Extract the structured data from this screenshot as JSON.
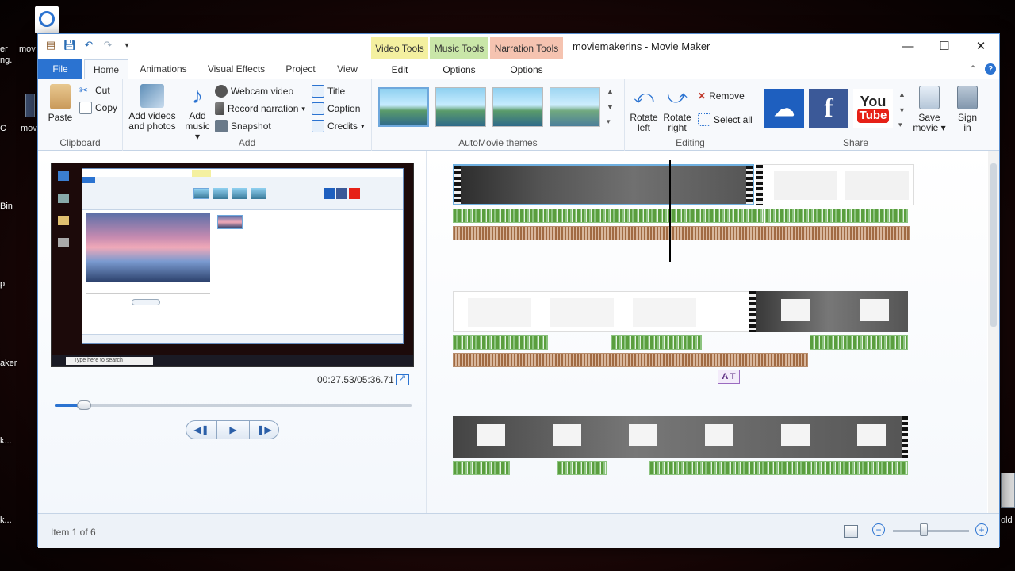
{
  "desktop": {
    "icons": [
      "er",
      "mov",
      "ng.",
      "C",
      "mov",
      "Bin",
      "p",
      "aker",
      "k...",
      "k...",
      "old"
    ]
  },
  "window": {
    "title": "moviemakerins - Movie Maker",
    "contextual_tabs": [
      {
        "group": "Video Tools",
        "tab": "Edit",
        "color": "#f4f0a0"
      },
      {
        "group": "Music Tools",
        "tab": "Options",
        "color": "#c9e6a8"
      },
      {
        "group": "Narration Tools",
        "tab": "Options",
        "color": "#f5c3b0"
      }
    ],
    "controls": {
      "minimize": "—",
      "maximize": "☐",
      "close": "✕"
    }
  },
  "tabs": [
    "File",
    "Home",
    "Animations",
    "Visual Effects",
    "Project",
    "View"
  ],
  "active_tab": "Home",
  "ribbon": {
    "clipboard": {
      "label": "Clipboard",
      "paste": "Paste",
      "cut": "Cut",
      "copy": "Copy"
    },
    "add": {
      "label": "Add",
      "add_videos_line1": "Add videos",
      "add_videos_line2": "and photos",
      "add_music_line1": "Add",
      "add_music_line2": "music",
      "webcam": "Webcam video",
      "record_narration": "Record narration",
      "snapshot": "Snapshot",
      "title": "Title",
      "caption": "Caption",
      "credits": "Credits"
    },
    "themes": {
      "label": "AutoMovie themes"
    },
    "editing": {
      "label": "Editing",
      "rotate_left_1": "Rotate",
      "rotate_left_2": "left",
      "rotate_right_1": "Rotate",
      "rotate_right_2": "right",
      "remove": "Remove",
      "select_all": "Select all"
    },
    "share": {
      "label": "Share",
      "save_movie_1": "Save",
      "save_movie_2": "movie",
      "sign_in_1": "Sign",
      "sign_in_2": "in",
      "youtube_1": "You",
      "youtube_2": "Tube",
      "facebook": "f"
    }
  },
  "preview": {
    "time": "00:27.53/05:36.71",
    "progress": 0.082,
    "mini_search": "Type here to search"
  },
  "storyboard": {
    "caption_tag": "A T"
  },
  "status": {
    "item_text": "Item 1 of 6",
    "zoom_level": 0.45
  }
}
